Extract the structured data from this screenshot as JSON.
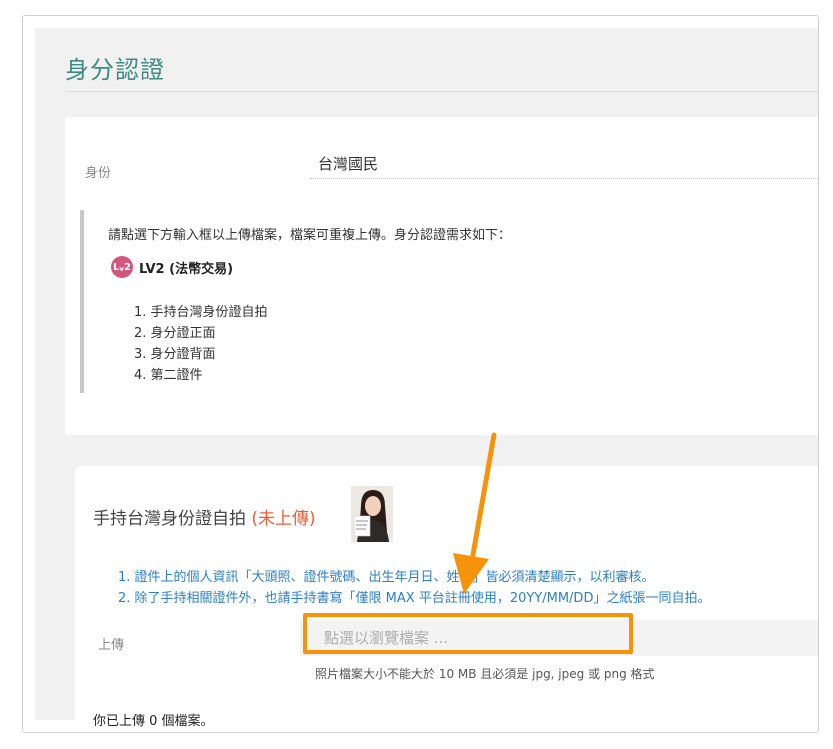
{
  "page": {
    "title": "身分認證"
  },
  "identity": {
    "label": "身份",
    "value": "台灣國民"
  },
  "notice": {
    "intro": "請點選下方輸入框以上傳檔案，檔案可重複上傳。身分認證需求如下：",
    "level_badge_main": "L",
    "level_badge_sub": "v",
    "level_badge_num": "2",
    "level_text": "LV2 (法幣交易)",
    "requirements": [
      "1. 手持台灣身份證自拍",
      "2. 身分證正面",
      "3. 身分證背面",
      "4. 第二證件"
    ]
  },
  "upload_section": {
    "title": "手持台灣身份證自拍",
    "status": "(未上傳)",
    "instructions": [
      "1. 證件上的個人資訊「大頭照、證件號碼、出生年月日、姓名」皆必須清楚顯示，以利審核。",
      "2. 除了手持相關證件外，也請手持書寫「僅限 MAX 平台註冊使用，20YY/MM/DD」之紙張一同自拍。"
    ],
    "upload_label": "上傳",
    "upload_placeholder": "點選以瀏覽檔案 ...",
    "hint": "照片檔案大小不能大於 10 MB 且必須是 jpg, jpeg 或 png 格式",
    "count_text": "你已上傳 0 個檔案。"
  },
  "colors": {
    "title_teal": "#3d8a83",
    "status_red": "#f05a3a",
    "instruction_blue": "#2d7ec8",
    "badge_pink": "#d0577e",
    "annotation_orange": "#f7930a"
  }
}
